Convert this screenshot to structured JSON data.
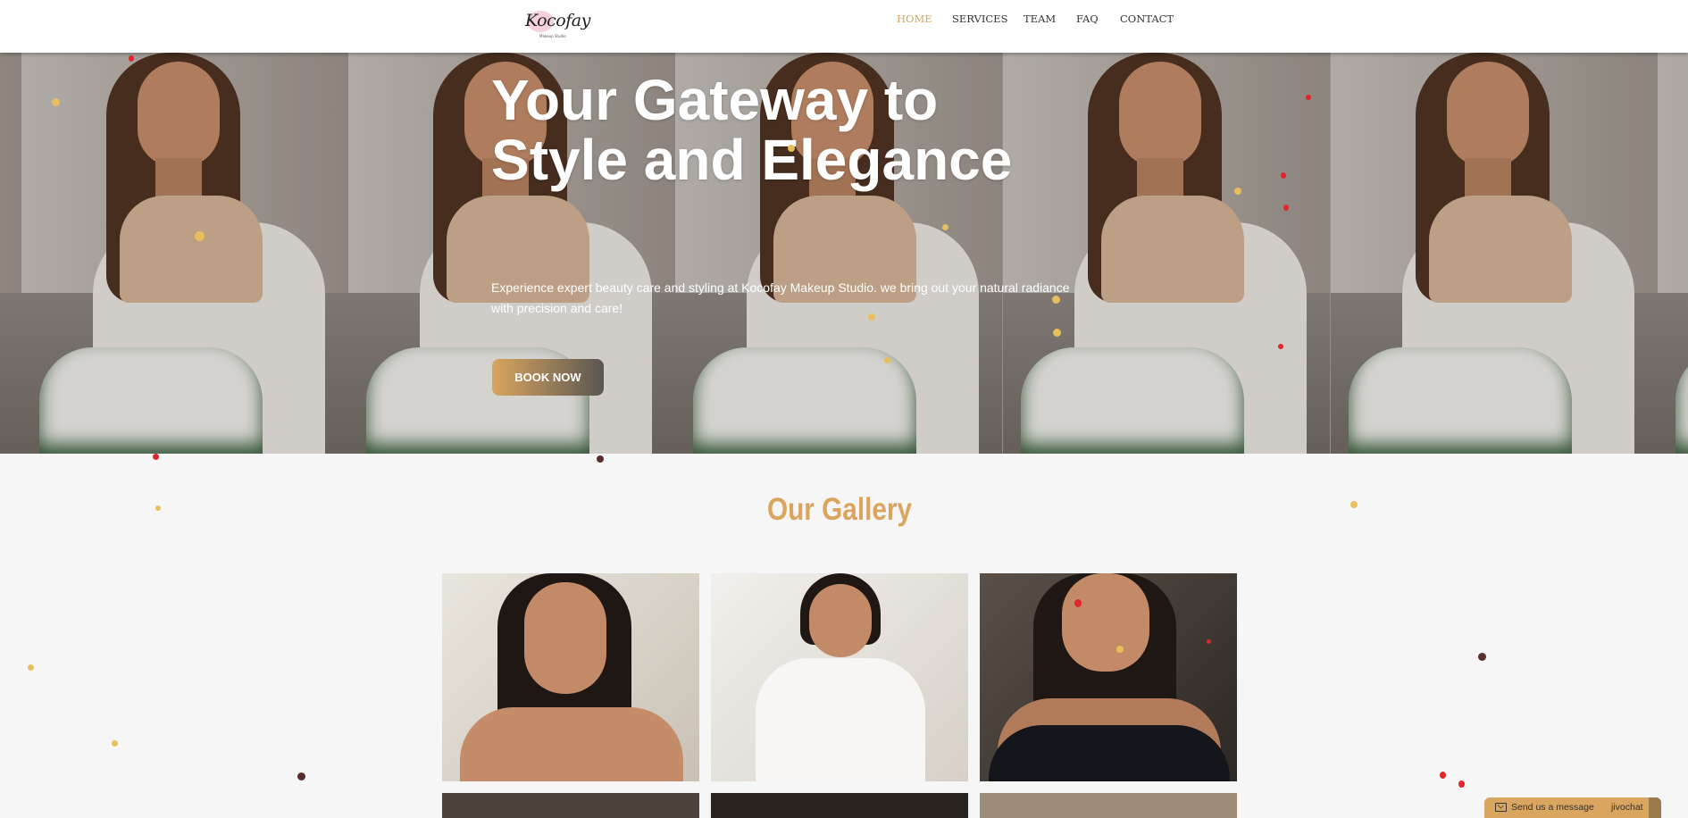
{
  "header": {
    "logo_text": "Kocofay",
    "logo_subtext": "Makeup Studio",
    "nav": [
      {
        "label": "HOME",
        "active": true
      },
      {
        "label": "SERVICES",
        "active": false
      },
      {
        "label": "TEAM",
        "active": false
      },
      {
        "label": "FAQ",
        "active": false
      },
      {
        "label": "CONTACT",
        "active": false
      }
    ]
  },
  "hero": {
    "title": "Your Gateway to Style and Elegance",
    "text": "Experience expert beauty care and styling at Kocofay Makeup Studio. we bring out your natural radiance with precision and care!",
    "button_label": "BOOK NOW"
  },
  "gallery": {
    "title": "Our Gallery"
  },
  "chat": {
    "label": "Send us a message",
    "brand": "jivochat"
  },
  "colors": {
    "accent": "#d9a55f",
    "header_bg": "#ffffff",
    "page_bg": "#f6f6f6"
  },
  "icons": [
    "envelope-icon"
  ]
}
